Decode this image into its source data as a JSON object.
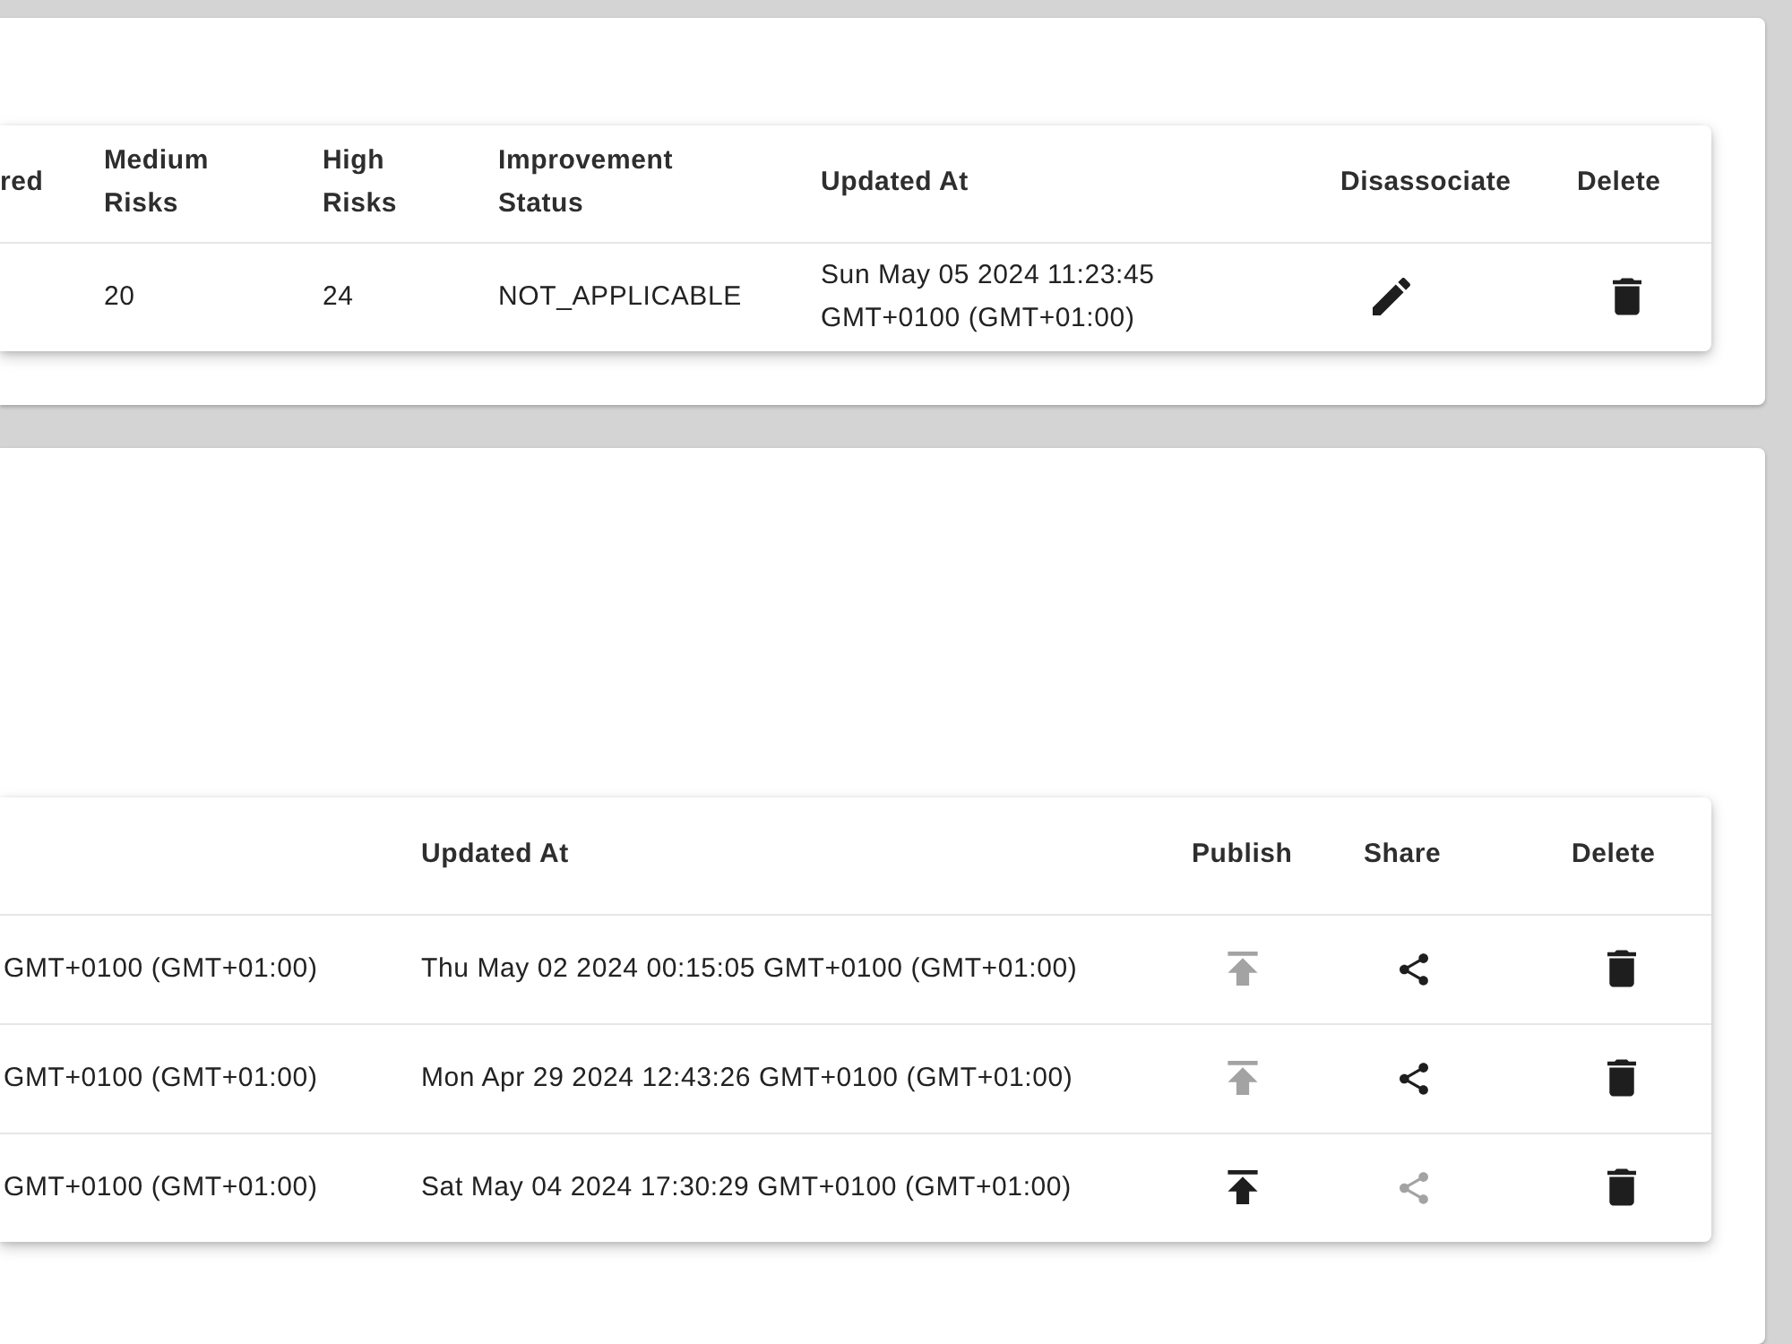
{
  "panels": [
    {
      "table": {
        "columns": [
          {
            "label": "red",
            "kind": "text"
          },
          {
            "label": "Medium Risks",
            "kind": "text"
          },
          {
            "label": "High Risks",
            "kind": "text"
          },
          {
            "label": "Improvement Status",
            "kind": "text"
          },
          {
            "label": "Updated At",
            "kind": "text"
          },
          {
            "label": "Disassociate",
            "kind": "action"
          },
          {
            "label": "Delete",
            "kind": "action"
          }
        ],
        "rows": [
          {
            "cells": [
              "",
              "20",
              "24",
              "NOT_APPLICABLE",
              "Sun May 05 2024 11:23:45 GMT+0100 (GMT+01:00)"
            ],
            "actions": [
              {
                "kind": "edit",
                "disabled": false
              },
              {
                "kind": "delete",
                "disabled": false
              }
            ]
          }
        ]
      }
    },
    {
      "table": {
        "columns": [
          {
            "kind": "text"
          },
          {
            "label": "Updated At",
            "kind": "text"
          },
          {
            "label": "Publish",
            "kind": "action"
          },
          {
            "label": "Share",
            "kind": "action"
          },
          {
            "label": "Delete",
            "kind": "action"
          }
        ],
        "rows": [
          {
            "cells": [
              "GMT+0100 (GMT+01:00)",
              "Thu May 02 2024 00:15:05 GMT+0100 (GMT+01:00)"
            ],
            "actions": [
              {
                "kind": "publish",
                "disabled": true
              },
              {
                "kind": "share",
                "disabled": false
              },
              {
                "kind": "delete",
                "disabled": false
              }
            ]
          },
          {
            "cells": [
              "GMT+0100 (GMT+01:00)",
              "Mon Apr 29 2024 12:43:26 GMT+0100 (GMT+01:00)"
            ],
            "actions": [
              {
                "kind": "publish",
                "disabled": true
              },
              {
                "kind": "share",
                "disabled": false
              },
              {
                "kind": "delete",
                "disabled": false
              }
            ]
          },
          {
            "cells": [
              "GMT+0100 (GMT+01:00)",
              "Sat May 04 2024 17:30:29 GMT+0100 (GMT+01:00)"
            ],
            "actions": [
              {
                "kind": "publish",
                "disabled": false
              },
              {
                "kind": "share",
                "disabled": true
              },
              {
                "kind": "delete",
                "disabled": false
              }
            ]
          }
        ]
      }
    }
  ]
}
